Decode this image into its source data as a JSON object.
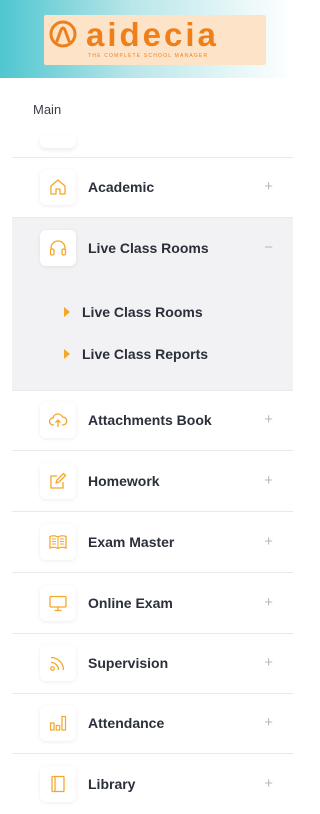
{
  "brand": {
    "name": "aidecia",
    "tagline": "THE COMPLETE SCHOOL MANAGER"
  },
  "section_label": "Main",
  "menu": [
    {
      "label": "Academic",
      "icon": "home-icon",
      "toggle": "+"
    },
    {
      "label": "Live Class Rooms",
      "icon": "headphones-icon",
      "toggle": "−"
    },
    {
      "label": "Attachments Book",
      "icon": "cloud-upload-icon",
      "toggle": "+"
    },
    {
      "label": "Homework",
      "icon": "edit-icon",
      "toggle": "+"
    },
    {
      "label": "Exam Master",
      "icon": "book-icon",
      "toggle": "+"
    },
    {
      "label": "Online Exam",
      "icon": "monitor-icon",
      "toggle": "+"
    },
    {
      "label": "Supervision",
      "icon": "rss-icon",
      "toggle": "+"
    },
    {
      "label": "Attendance",
      "icon": "bar-chart-icon",
      "toggle": "+"
    },
    {
      "label": "Library",
      "icon": "library-book-icon",
      "toggle": "+"
    }
  ],
  "submenu": [
    {
      "label": "Live Class Rooms"
    },
    {
      "label": "Live Class Reports"
    }
  ],
  "colors": {
    "accent": "#f4a728",
    "brand": "#ef7f1b",
    "active_bg": "#f2f2f4",
    "text": "#2b2f3a"
  }
}
